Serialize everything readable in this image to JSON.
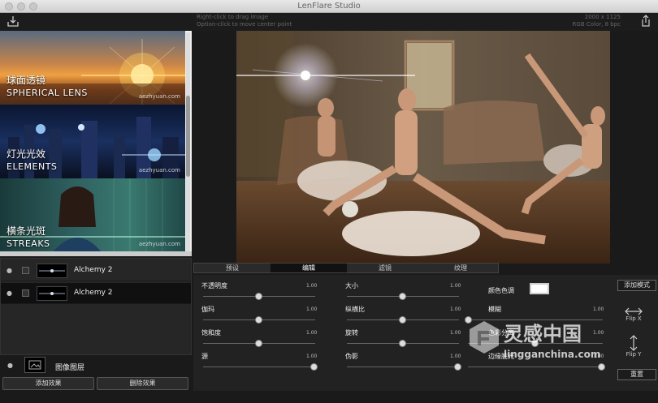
{
  "window": {
    "title": "LenFlare Studio"
  },
  "hints": {
    "line1": "Right-click to drag image",
    "line2": "Option-click to move center point"
  },
  "image_info": {
    "size": "2000 x 1125",
    "mode": "RGB Color, 8 bpc"
  },
  "presets": [
    {
      "cn": "球面透镜",
      "en": "SPHERICAL LENS",
      "wm": "aezhyuan.com"
    },
    {
      "cn": "灯光光效",
      "en": "ELEMENTS",
      "wm": "aezhyuan.com"
    },
    {
      "cn": "横条光斑",
      "en": "STREAKS",
      "wm": "aezhyuan.com"
    }
  ],
  "layers": [
    {
      "name": "Alchemy 2",
      "selected": false
    },
    {
      "name": "Alchemy 2",
      "selected": true
    }
  ],
  "image_layer": {
    "label": "图像图层"
  },
  "buttons": {
    "add_effect": "添加效果",
    "delete_effect": "删除效果",
    "add_mode": "添加模式",
    "reset": "重置"
  },
  "tabs": [
    "预设",
    "编辑",
    "滤镜",
    "纹理"
  ],
  "active_tab": "编辑",
  "sliders": {
    "col1": [
      {
        "label": "不透明度",
        "value": "1.00",
        "level": 0.5
      },
      {
        "label": "伽玛",
        "value": "1.00",
        "level": 0.5
      },
      {
        "label": "饱和度",
        "value": "1.00",
        "level": 0.5
      },
      {
        "label": "源",
        "value": "1.00",
        "level": 1.0
      }
    ],
    "col2": [
      {
        "label": "大小",
        "value": "1.00",
        "level": 0.5
      },
      {
        "label": "纵横比",
        "value": "1.00",
        "level": 0.5
      },
      {
        "label": "旋转",
        "value": "1.00",
        "level": 0.5
      },
      {
        "label": "伪影",
        "value": "1.00",
        "level": 1.0
      }
    ],
    "col3": [
      {
        "label": "模糊",
        "value": "1.00",
        "level": 0.0
      },
      {
        "label": "色彩分离",
        "value": "1.00",
        "level": 0.5
      },
      {
        "label": "边缘脏光",
        "value": "1.00",
        "level": 1.0
      }
    ]
  },
  "tint": {
    "label": "颜色色调",
    "color": "#ffffff"
  },
  "flip": {
    "x": "Flip X",
    "y": "Flip Y"
  },
  "watermark": {
    "cn": "灵感中国",
    "url": "lingganchina.com"
  }
}
